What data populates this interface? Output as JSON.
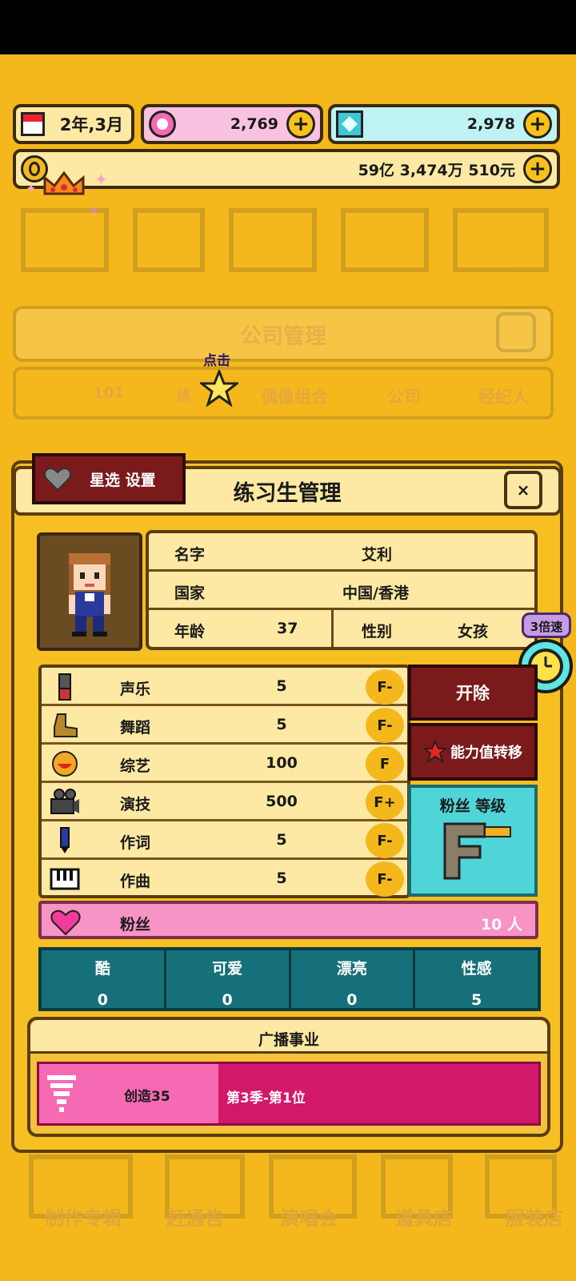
{
  "resources": {
    "date": "2年,3月",
    "pink_gems": "2,769",
    "diamonds": "2,978",
    "money": "59亿 3,474万 510元"
  },
  "background": {
    "panel_title": "公司管理",
    "tabs": [
      "101",
      "练",
      "偶像组合",
      "公司",
      "经纪人"
    ],
    "hint": "点击",
    "bottom_nav": [
      "制作专辑",
      "赶通告",
      "演唱会",
      "道具店",
      "服装店"
    ]
  },
  "modal": {
    "title": "练习生管理",
    "star_button": "星选 设置",
    "close_glyph": "×"
  },
  "profile": {
    "name_label": "名字",
    "name": "艾利",
    "country_label": "国家",
    "country": "中国/香港",
    "age_label": "年龄",
    "age": "37",
    "gender_label": "性别",
    "gender": "女孩"
  },
  "stats": [
    {
      "name": "声乐",
      "value": "5",
      "grade": "F-",
      "icon": "microphone-icon"
    },
    {
      "name": "舞蹈",
      "value": "5",
      "grade": "F-",
      "icon": "boot-icon"
    },
    {
      "name": "综艺",
      "value": "100",
      "grade": "F",
      "icon": "smile-icon"
    },
    {
      "name": "演技",
      "value": "500",
      "grade": "F+",
      "icon": "camera-icon"
    },
    {
      "name": "作词",
      "value": "5",
      "grade": "F-",
      "icon": "pen-icon"
    },
    {
      "name": "作曲",
      "value": "5",
      "grade": "F-",
      "icon": "piano-icon"
    }
  ],
  "fans": {
    "label": "粉丝",
    "value": "10 人"
  },
  "actions": {
    "fire": "开除",
    "transfer": "能力值转移",
    "fan_level_label": "粉丝 等级",
    "fan_level_grade": "F"
  },
  "speed": {
    "label": "3倍速"
  },
  "traits": [
    {
      "name": "酷",
      "value": "0"
    },
    {
      "name": "可爱",
      "value": "0"
    },
    {
      "name": "漂亮",
      "value": "0"
    },
    {
      "name": "性感",
      "value": "5"
    }
  ],
  "broadcast": {
    "title": "广播事业",
    "program": "创造35",
    "rank": "第3季-第1位"
  },
  "colors": {
    "background": "#F5B81C",
    "modal": "#F6BF22",
    "cream": "#FDE9A3",
    "maroon": "#7A1A1A",
    "teal": "#16707A",
    "cyan": "#4FD5D7",
    "pink": "#F893C6",
    "magenta": "#D2186B"
  }
}
